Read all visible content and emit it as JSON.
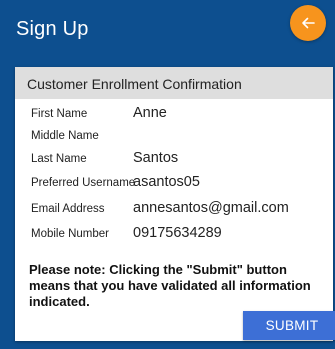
{
  "appbar": {
    "title": "Sign Up"
  },
  "card": {
    "header_title": "Customer Enrollment Confirmation",
    "back_icon": "arrow-left-icon",
    "fields": [
      {
        "label": "First Name",
        "value": "Anne"
      },
      {
        "label": "Middle Name",
        "value": ""
      },
      {
        "label": "Last Name",
        "value": "Santos"
      },
      {
        "label": "Preferred Username",
        "value": "asantos05"
      },
      {
        "label": "Email Address",
        "value": "annesantos@gmail.com"
      },
      {
        "label": "Mobile Number",
        "value": "09175634289"
      }
    ],
    "notice": "Please note: Clicking the \"Submit\" button means that you have validated all information indicated.",
    "submit_label": "SUBMIT"
  },
  "colors": {
    "primary": "#0d4f8f",
    "header_bg": "#dedede",
    "accent_orange": "#f7941d",
    "submit_blue": "#3d6fd6"
  }
}
